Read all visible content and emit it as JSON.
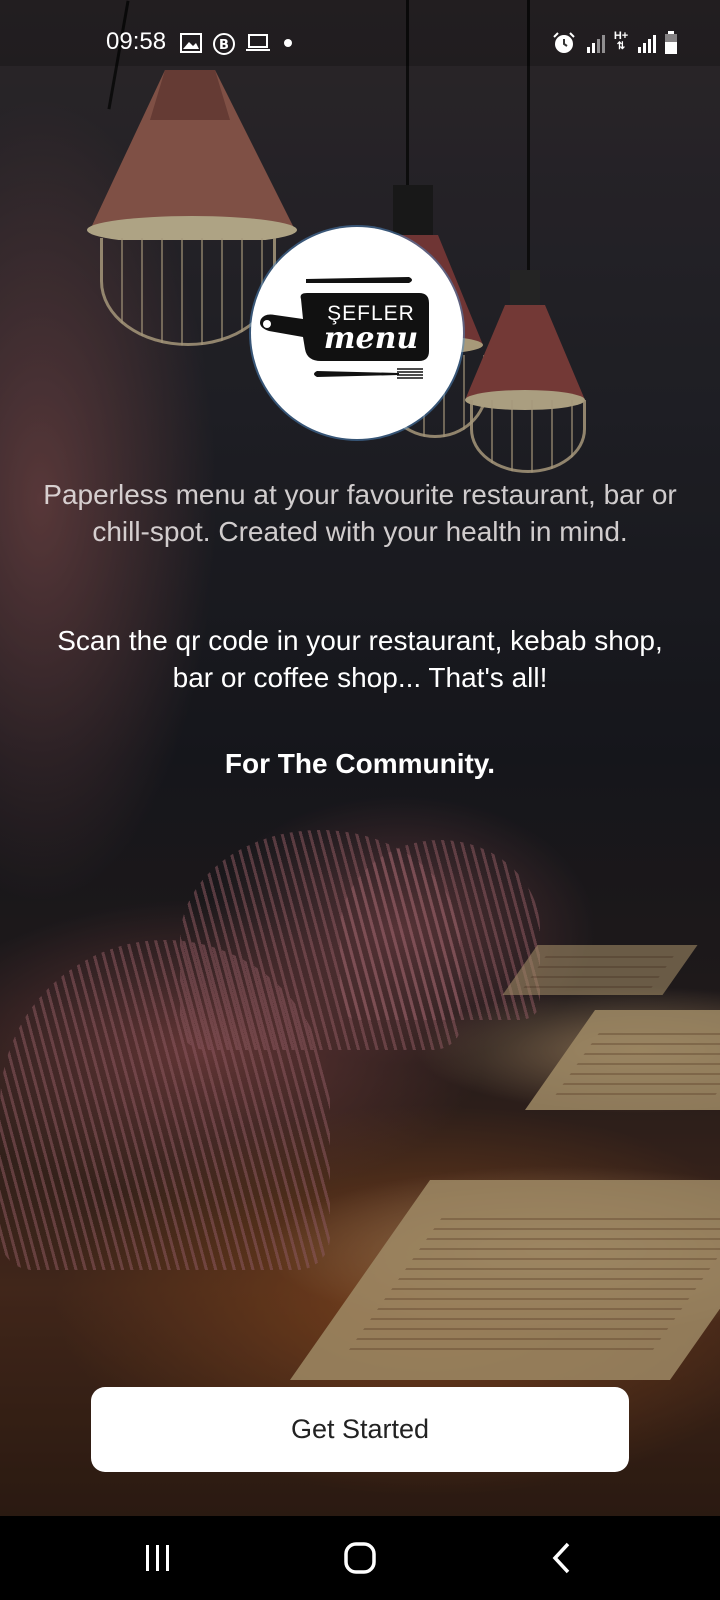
{
  "status_bar": {
    "time": "09:58",
    "left_icons": [
      "image-icon",
      "b-badge-icon",
      "laptop-icon",
      "dot-icon"
    ],
    "right_icons": [
      "alarm-icon",
      "signal-icon",
      "h-plus-data-icon",
      "signal-icon",
      "battery-icon"
    ],
    "network_label": "H+"
  },
  "logo": {
    "top_text": "ŞEFLER",
    "bottom_text": "menu"
  },
  "content": {
    "intro": "Paperless menu at your favourite restaurant, bar or chill-spot. Created with your health in mind.",
    "scan": "Scan the qr code in your restaurant, kebab shop, bar or coffee shop... That's all!",
    "community": "For The Community."
  },
  "actions": {
    "get_started_label": "Get Started"
  },
  "nav_bar": {
    "buttons": [
      "recents-icon",
      "home-icon",
      "back-icon"
    ]
  },
  "colors": {
    "button_bg": "#ffffff",
    "button_text": "#222222",
    "nav_bg": "#000000"
  }
}
